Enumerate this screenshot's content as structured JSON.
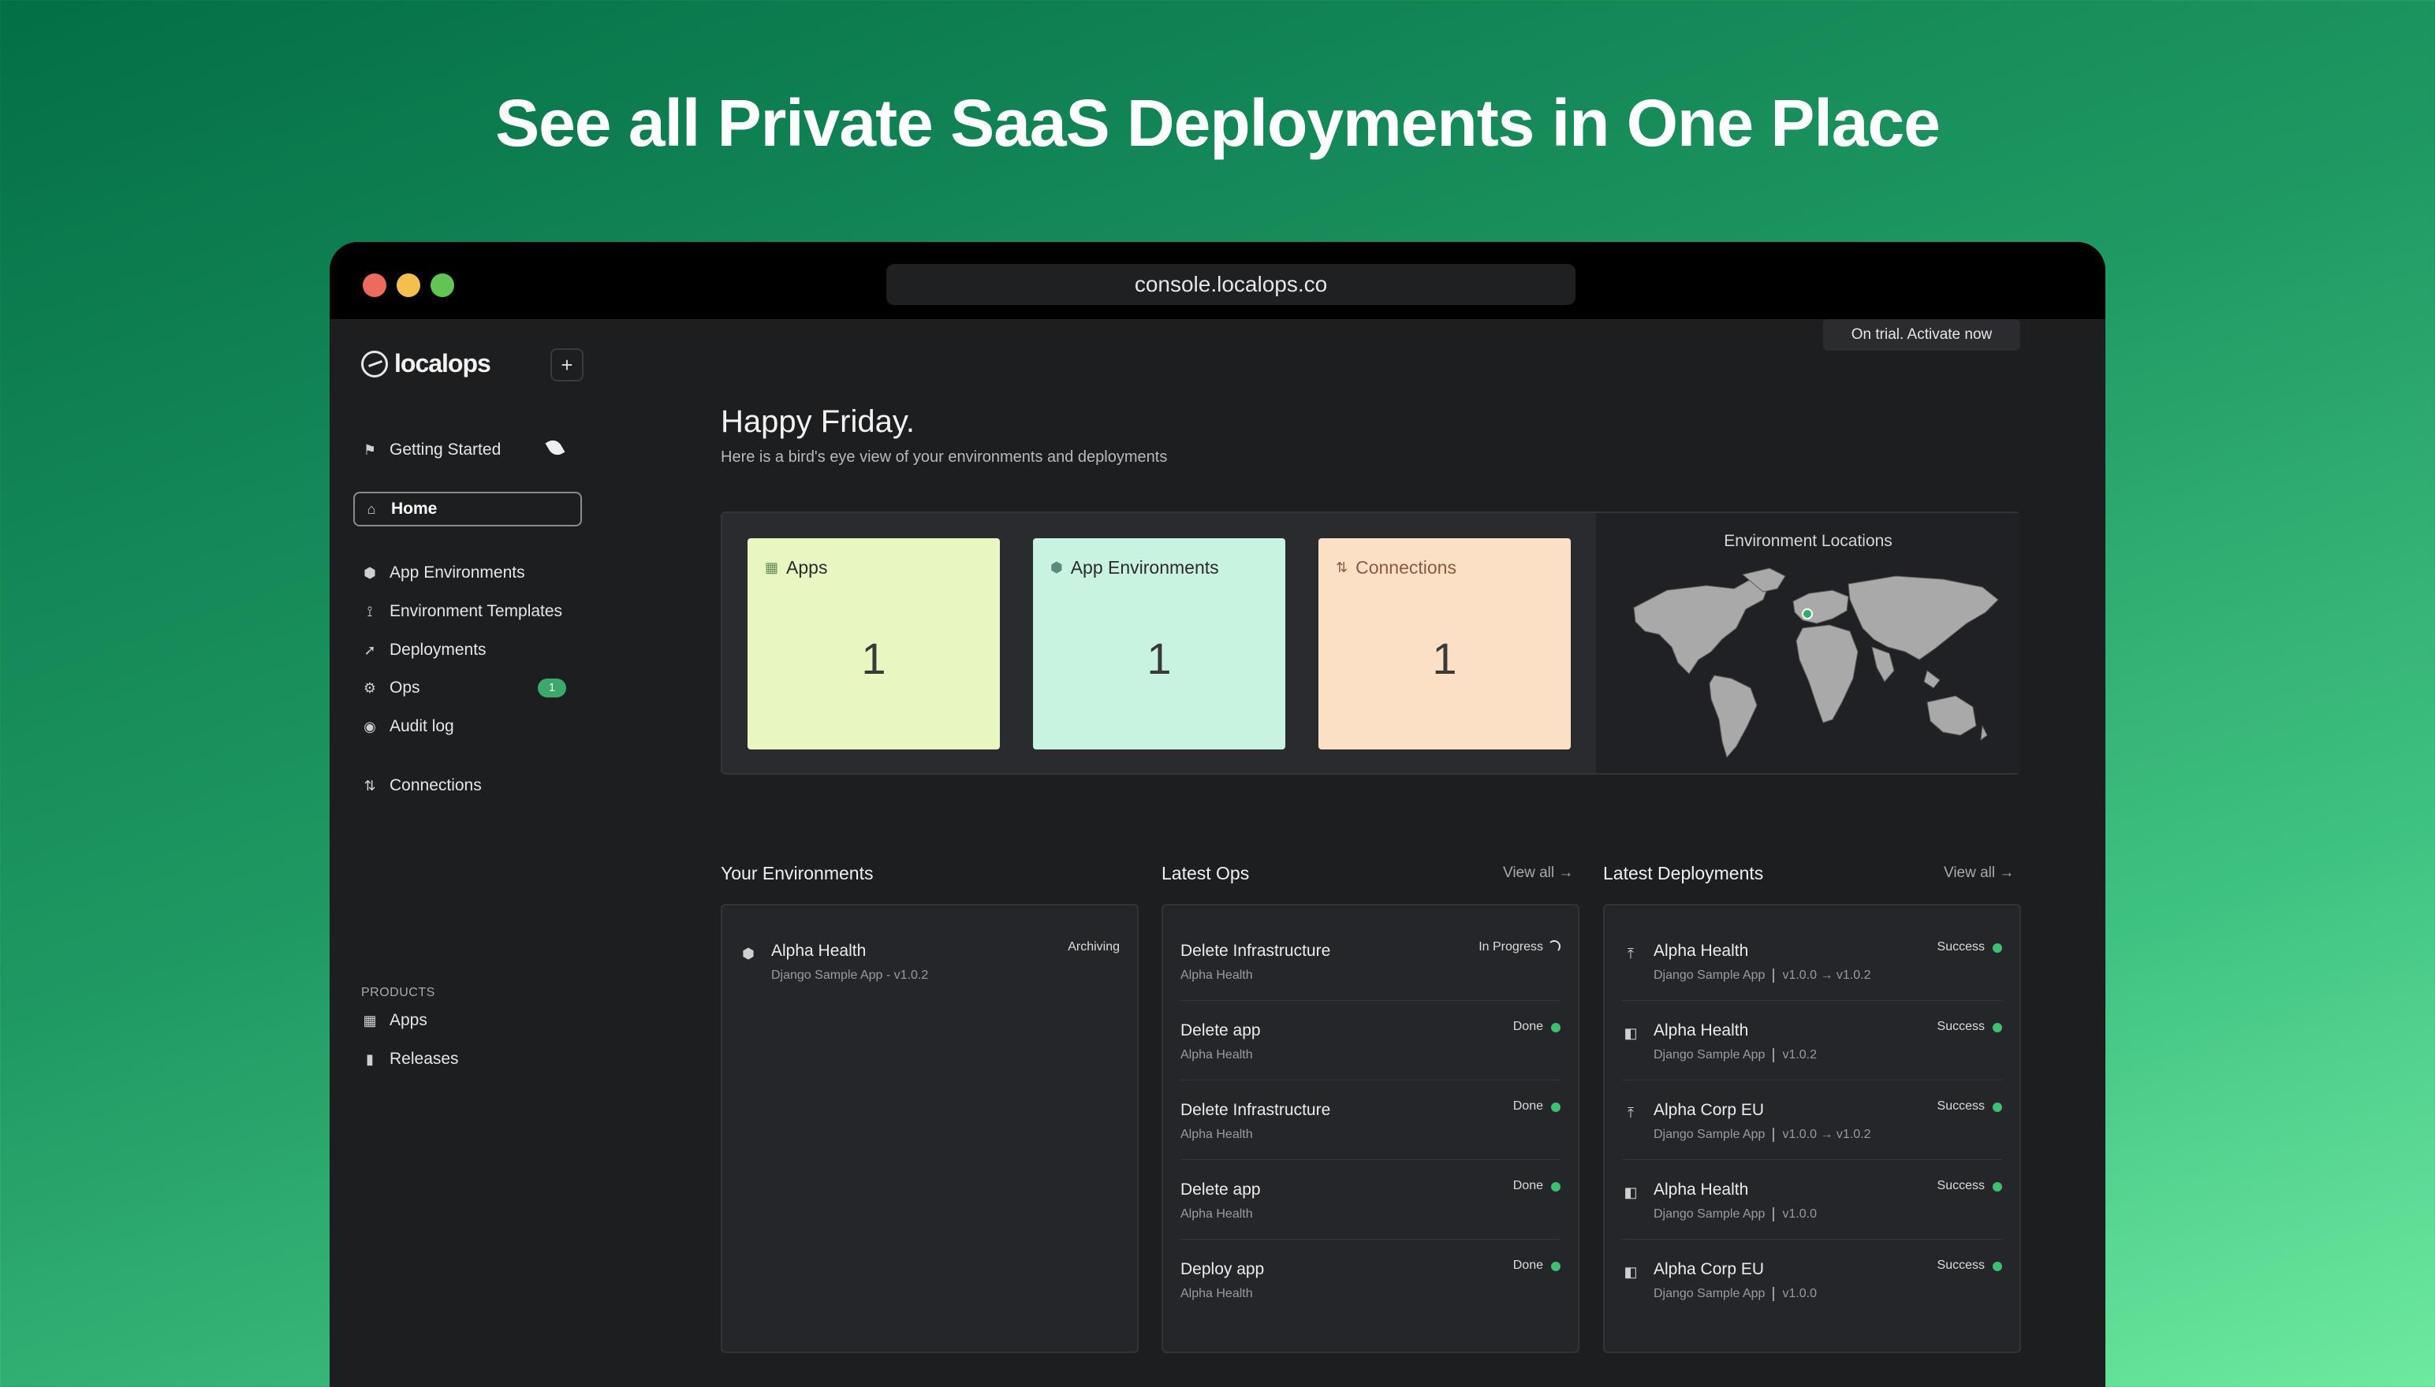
{
  "headline": "See all Private SaaS Deployments in One Place",
  "browser": {
    "url": "console.localops.co"
  },
  "sidebar": {
    "brand": "localops",
    "plus": "+",
    "getting_started": "Getting Started",
    "home": "Home",
    "items": [
      {
        "label": "App Environments"
      },
      {
        "label": "Environment Templates"
      },
      {
        "label": "Deployments"
      },
      {
        "label": "Ops",
        "badge": "1"
      },
      {
        "label": "Audit log"
      }
    ],
    "connections": "Connections",
    "products_label": "PRODUCTS",
    "products": [
      {
        "label": "Apps"
      },
      {
        "label": "Releases"
      }
    ]
  },
  "trial": "On trial.  Activate now",
  "greeting": "Happy Friday.",
  "subtext": "Here is a bird's eye view of your environments and deployments",
  "stats": [
    {
      "label": "Apps",
      "value": "1",
      "color": "#e8f7c2"
    },
    {
      "label": "App Environments",
      "value": "1",
      "color": "#c8f3e1"
    },
    {
      "label": "Connections",
      "value": "1",
      "color": "#fbe0c6"
    }
  ],
  "map": {
    "title": "Environment Locations"
  },
  "environments": {
    "title": "Your Environments",
    "rows": [
      {
        "title": "Alpha Health",
        "sub": "Django Sample App - v1.0.2",
        "status": "Archiving"
      }
    ]
  },
  "ops": {
    "title": "Latest Ops",
    "view_all": "View all →",
    "rows": [
      {
        "title": "Delete Infrastructure",
        "sub": "Alpha Health",
        "status": "In Progress"
      },
      {
        "title": "Delete app",
        "sub": "Alpha Health",
        "status": "Done"
      },
      {
        "title": "Delete Infrastructure",
        "sub": "Alpha Health",
        "status": "Done"
      },
      {
        "title": "Delete app",
        "sub": "Alpha Health",
        "status": "Done"
      },
      {
        "title": "Deploy app",
        "sub": "Alpha Health",
        "status": "Done"
      }
    ]
  },
  "deployments": {
    "title": "Latest Deployments",
    "view_all": "View all →",
    "rows": [
      {
        "title": "Alpha Health",
        "app": "Django Sample App",
        "version": "v1.0.0 → v1.0.2",
        "status": "Success",
        "icon": "upgrade-icon"
      },
      {
        "title": "Alpha Health",
        "app": "Django Sample App",
        "version": "v1.0.2",
        "status": "Success",
        "icon": "deploy-icon"
      },
      {
        "title": "Alpha Corp EU",
        "app": "Django Sample App",
        "version": "v1.0.0 → v1.0.2",
        "status": "Success",
        "icon": "upgrade-icon"
      },
      {
        "title": "Alpha Health",
        "app": "Django Sample App",
        "version": "v1.0.0",
        "status": "Success",
        "icon": "deploy-icon"
      },
      {
        "title": "Alpha Corp EU",
        "app": "Django Sample App",
        "version": "v1.0.0",
        "status": "Success",
        "icon": "deploy-icon"
      }
    ]
  }
}
